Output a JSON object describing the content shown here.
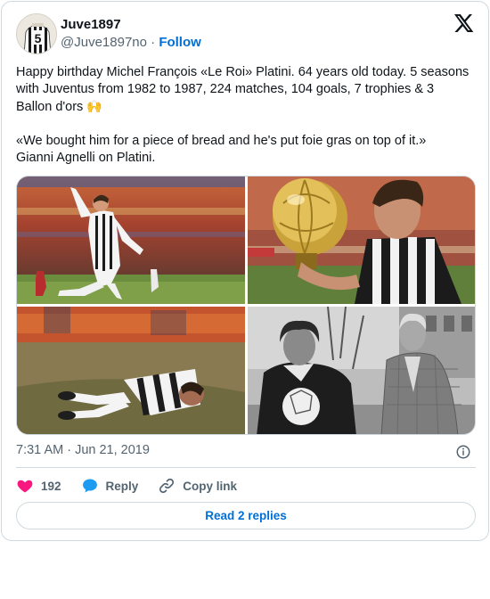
{
  "author": {
    "display_name": "Juve1897",
    "handle": "@Juve1897no",
    "separator": "·",
    "follow_label": "Follow"
  },
  "tweet": {
    "paragraph_1": "Happy birthday Michel François «Le Roi» Platini. 64 years old today. 5 seasons with Juventus from 1982 to 1987, 224 matches, 104 goals, 7 trophies & 3 Ballon d'ors",
    "paragraph_1_emoji": "🙌",
    "paragraph_2_line_1": "«We bought him for a piece of bread and he's put foie gras on top of it.»",
    "paragraph_2_line_2": "Gianni Agnelli on Platini."
  },
  "media": {
    "photo_count": 4
  },
  "meta": {
    "timestamp": "7:31 AM · Jun 21, 2019"
  },
  "actions": {
    "likes_count": "192",
    "reply_label": "Reply",
    "copy_link_label": "Copy link"
  },
  "replies_button_label": "Read 2 replies",
  "colors": {
    "accent": "#006fd6",
    "like": "#f91880",
    "reply_bubble": "#1d9bf0",
    "text_secondary": "#536471",
    "border": "#cfd9de"
  }
}
